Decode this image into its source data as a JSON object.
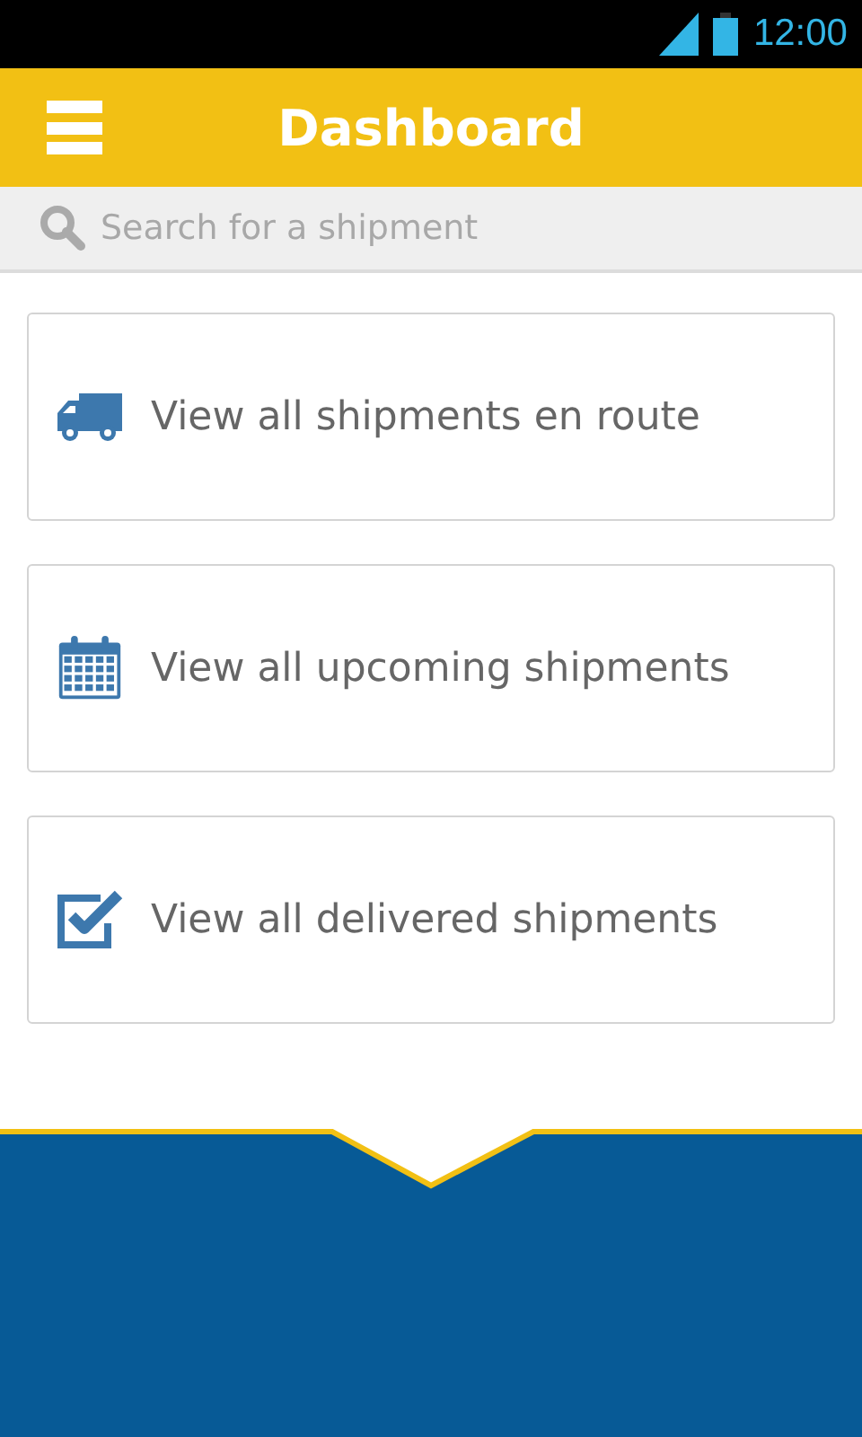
{
  "status_bar": {
    "time": "12:00"
  },
  "app_bar": {
    "title": "Dashboard"
  },
  "search": {
    "placeholder": "Search for a shipment"
  },
  "cards": [
    {
      "kind": "truck",
      "label": "View all shipments en route"
    },
    {
      "kind": "calendar",
      "label": "View all upcoming shipments"
    },
    {
      "kind": "check",
      "label": "View all delivered shipments"
    }
  ]
}
